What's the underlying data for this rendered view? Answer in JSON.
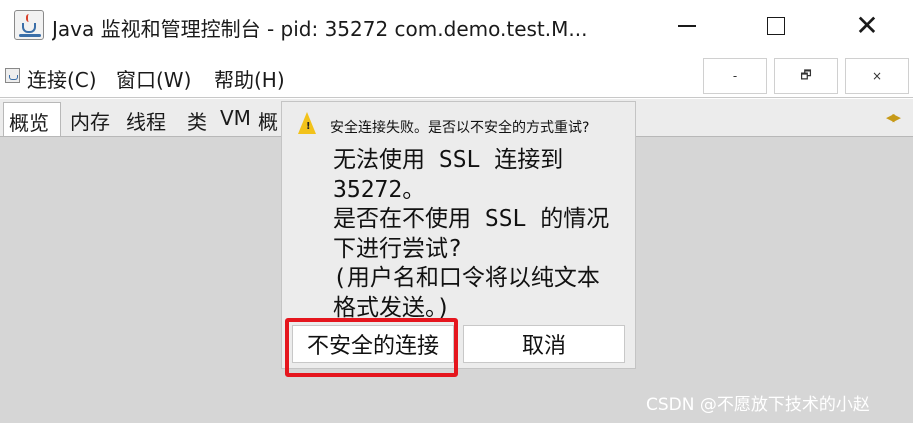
{
  "window": {
    "title": "Java 监视和管理控制台 - pid: 35272 com.demo.test.M...",
    "minimize_glyph": "—",
    "close_glyph": "✕"
  },
  "menubar": {
    "items": [
      "连接(C)",
      "窗口(W)",
      "帮助(H)"
    ],
    "mdi_buttons": [
      "-",
      "🗗",
      "×"
    ]
  },
  "tabs": {
    "items": [
      "概览",
      "内存",
      "线程",
      "类",
      "VM",
      "概"
    ],
    "selected": "概览"
  },
  "dialog": {
    "title": "安全连接失败。是否以不安全的方式重试?",
    "message": "无法使用 SSL 连接到\n35272。\n是否在不使用 SSL 的情况\n下进行尝试?\n(用户名和口令将以纯文本\n格式发送。)",
    "buttons": {
      "insecure": "不安全的连接",
      "cancel": "取消"
    },
    "highlight_color": "#e5161e"
  },
  "watermark": "CSDN @不愿放下技术的小赵",
  "icons": [
    "java-cup-icon",
    "warning-icon",
    "tab-scroll-arrows-icon"
  ]
}
